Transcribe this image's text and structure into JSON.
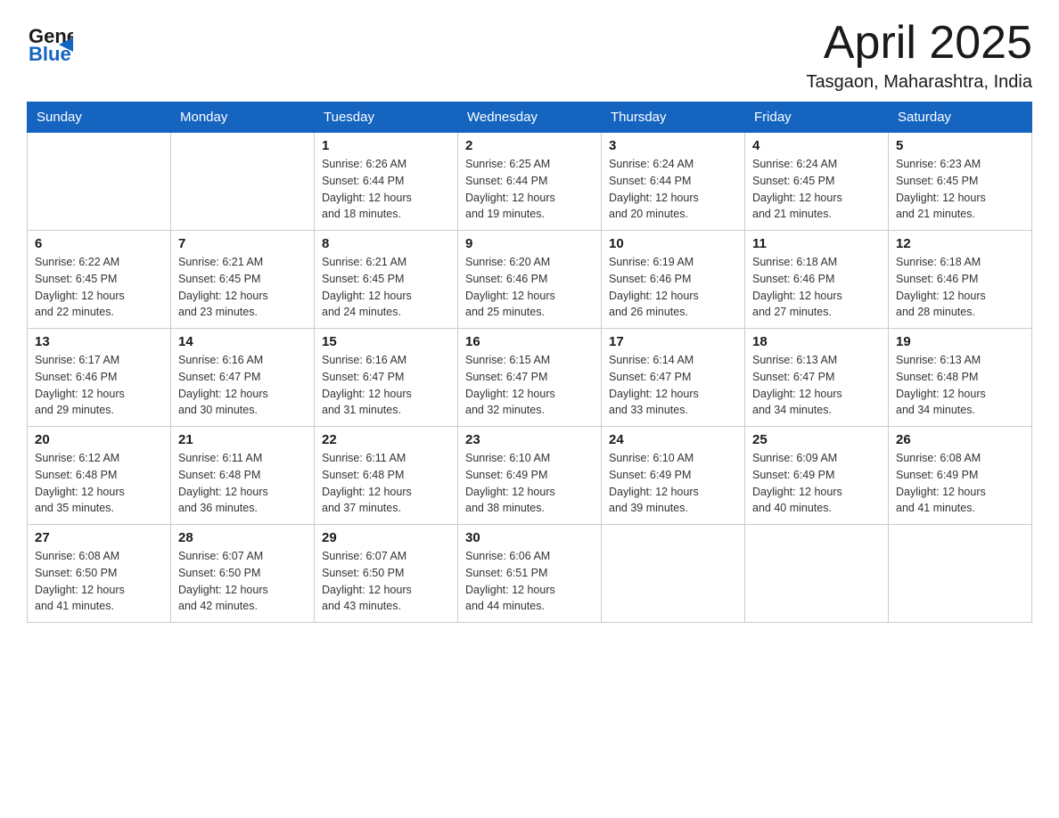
{
  "logo": {
    "text_general": "General",
    "text_blue": "Blue"
  },
  "header": {
    "title": "April 2025",
    "location": "Tasgaon, Maharashtra, India"
  },
  "calendar": {
    "days_of_week": [
      "Sunday",
      "Monday",
      "Tuesday",
      "Wednesday",
      "Thursday",
      "Friday",
      "Saturday"
    ],
    "weeks": [
      [
        {
          "day": "",
          "info": ""
        },
        {
          "day": "",
          "info": ""
        },
        {
          "day": "1",
          "info": "Sunrise: 6:26 AM\nSunset: 6:44 PM\nDaylight: 12 hours\nand 18 minutes."
        },
        {
          "day": "2",
          "info": "Sunrise: 6:25 AM\nSunset: 6:44 PM\nDaylight: 12 hours\nand 19 minutes."
        },
        {
          "day": "3",
          "info": "Sunrise: 6:24 AM\nSunset: 6:44 PM\nDaylight: 12 hours\nand 20 minutes."
        },
        {
          "day": "4",
          "info": "Sunrise: 6:24 AM\nSunset: 6:45 PM\nDaylight: 12 hours\nand 21 minutes."
        },
        {
          "day": "5",
          "info": "Sunrise: 6:23 AM\nSunset: 6:45 PM\nDaylight: 12 hours\nand 21 minutes."
        }
      ],
      [
        {
          "day": "6",
          "info": "Sunrise: 6:22 AM\nSunset: 6:45 PM\nDaylight: 12 hours\nand 22 minutes."
        },
        {
          "day": "7",
          "info": "Sunrise: 6:21 AM\nSunset: 6:45 PM\nDaylight: 12 hours\nand 23 minutes."
        },
        {
          "day": "8",
          "info": "Sunrise: 6:21 AM\nSunset: 6:45 PM\nDaylight: 12 hours\nand 24 minutes."
        },
        {
          "day": "9",
          "info": "Sunrise: 6:20 AM\nSunset: 6:46 PM\nDaylight: 12 hours\nand 25 minutes."
        },
        {
          "day": "10",
          "info": "Sunrise: 6:19 AM\nSunset: 6:46 PM\nDaylight: 12 hours\nand 26 minutes."
        },
        {
          "day": "11",
          "info": "Sunrise: 6:18 AM\nSunset: 6:46 PM\nDaylight: 12 hours\nand 27 minutes."
        },
        {
          "day": "12",
          "info": "Sunrise: 6:18 AM\nSunset: 6:46 PM\nDaylight: 12 hours\nand 28 minutes."
        }
      ],
      [
        {
          "day": "13",
          "info": "Sunrise: 6:17 AM\nSunset: 6:46 PM\nDaylight: 12 hours\nand 29 minutes."
        },
        {
          "day": "14",
          "info": "Sunrise: 6:16 AM\nSunset: 6:47 PM\nDaylight: 12 hours\nand 30 minutes."
        },
        {
          "day": "15",
          "info": "Sunrise: 6:16 AM\nSunset: 6:47 PM\nDaylight: 12 hours\nand 31 minutes."
        },
        {
          "day": "16",
          "info": "Sunrise: 6:15 AM\nSunset: 6:47 PM\nDaylight: 12 hours\nand 32 minutes."
        },
        {
          "day": "17",
          "info": "Sunrise: 6:14 AM\nSunset: 6:47 PM\nDaylight: 12 hours\nand 33 minutes."
        },
        {
          "day": "18",
          "info": "Sunrise: 6:13 AM\nSunset: 6:47 PM\nDaylight: 12 hours\nand 34 minutes."
        },
        {
          "day": "19",
          "info": "Sunrise: 6:13 AM\nSunset: 6:48 PM\nDaylight: 12 hours\nand 34 minutes."
        }
      ],
      [
        {
          "day": "20",
          "info": "Sunrise: 6:12 AM\nSunset: 6:48 PM\nDaylight: 12 hours\nand 35 minutes."
        },
        {
          "day": "21",
          "info": "Sunrise: 6:11 AM\nSunset: 6:48 PM\nDaylight: 12 hours\nand 36 minutes."
        },
        {
          "day": "22",
          "info": "Sunrise: 6:11 AM\nSunset: 6:48 PM\nDaylight: 12 hours\nand 37 minutes."
        },
        {
          "day": "23",
          "info": "Sunrise: 6:10 AM\nSunset: 6:49 PM\nDaylight: 12 hours\nand 38 minutes."
        },
        {
          "day": "24",
          "info": "Sunrise: 6:10 AM\nSunset: 6:49 PM\nDaylight: 12 hours\nand 39 minutes."
        },
        {
          "day": "25",
          "info": "Sunrise: 6:09 AM\nSunset: 6:49 PM\nDaylight: 12 hours\nand 40 minutes."
        },
        {
          "day": "26",
          "info": "Sunrise: 6:08 AM\nSunset: 6:49 PM\nDaylight: 12 hours\nand 41 minutes."
        }
      ],
      [
        {
          "day": "27",
          "info": "Sunrise: 6:08 AM\nSunset: 6:50 PM\nDaylight: 12 hours\nand 41 minutes."
        },
        {
          "day": "28",
          "info": "Sunrise: 6:07 AM\nSunset: 6:50 PM\nDaylight: 12 hours\nand 42 minutes."
        },
        {
          "day": "29",
          "info": "Sunrise: 6:07 AM\nSunset: 6:50 PM\nDaylight: 12 hours\nand 43 minutes."
        },
        {
          "day": "30",
          "info": "Sunrise: 6:06 AM\nSunset: 6:51 PM\nDaylight: 12 hours\nand 44 minutes."
        },
        {
          "day": "",
          "info": ""
        },
        {
          "day": "",
          "info": ""
        },
        {
          "day": "",
          "info": ""
        }
      ]
    ]
  }
}
